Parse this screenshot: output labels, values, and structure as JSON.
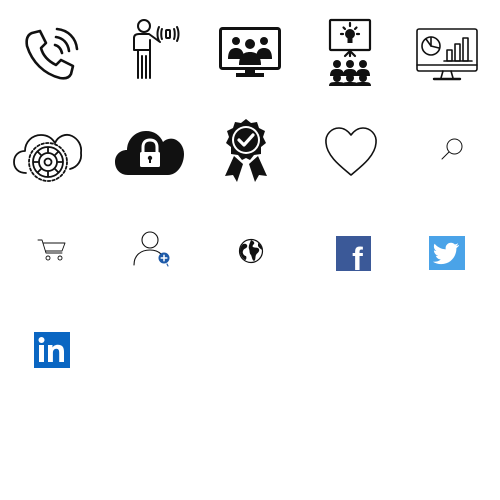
{
  "icons": [
    {
      "name": "phone-call-icon",
      "label": ""
    },
    {
      "name": "presenter-speaking-icon",
      "label": ""
    },
    {
      "name": "video-conference-icon",
      "label": ""
    },
    {
      "name": "idea-presentation-icon",
      "label": ""
    },
    {
      "name": "analytics-monitor-icon",
      "label": ""
    },
    {
      "name": "cloud-settings-icon",
      "label": ""
    },
    {
      "name": "cloud-lock-icon",
      "label": ""
    },
    {
      "name": "award-badge-icon",
      "label": ""
    },
    {
      "name": "heart-icon",
      "label": ""
    },
    {
      "name": "search-icon",
      "label": ""
    },
    {
      "name": "shopping-cart-icon",
      "label": ""
    },
    {
      "name": "add-user-icon",
      "label": ""
    },
    {
      "name": "globe-icon",
      "label": ""
    },
    {
      "name": "facebook-icon",
      "label": "f"
    },
    {
      "name": "twitter-icon",
      "label": ""
    },
    {
      "name": "linkedin-icon",
      "label": "in"
    }
  ],
  "colors": {
    "ink": "#111111",
    "accent_blue": "#1e5aa8",
    "facebook": "#3b5998",
    "twitter": "#4aa3e8",
    "linkedin": "#0a66c2",
    "background": "#ffffff"
  }
}
